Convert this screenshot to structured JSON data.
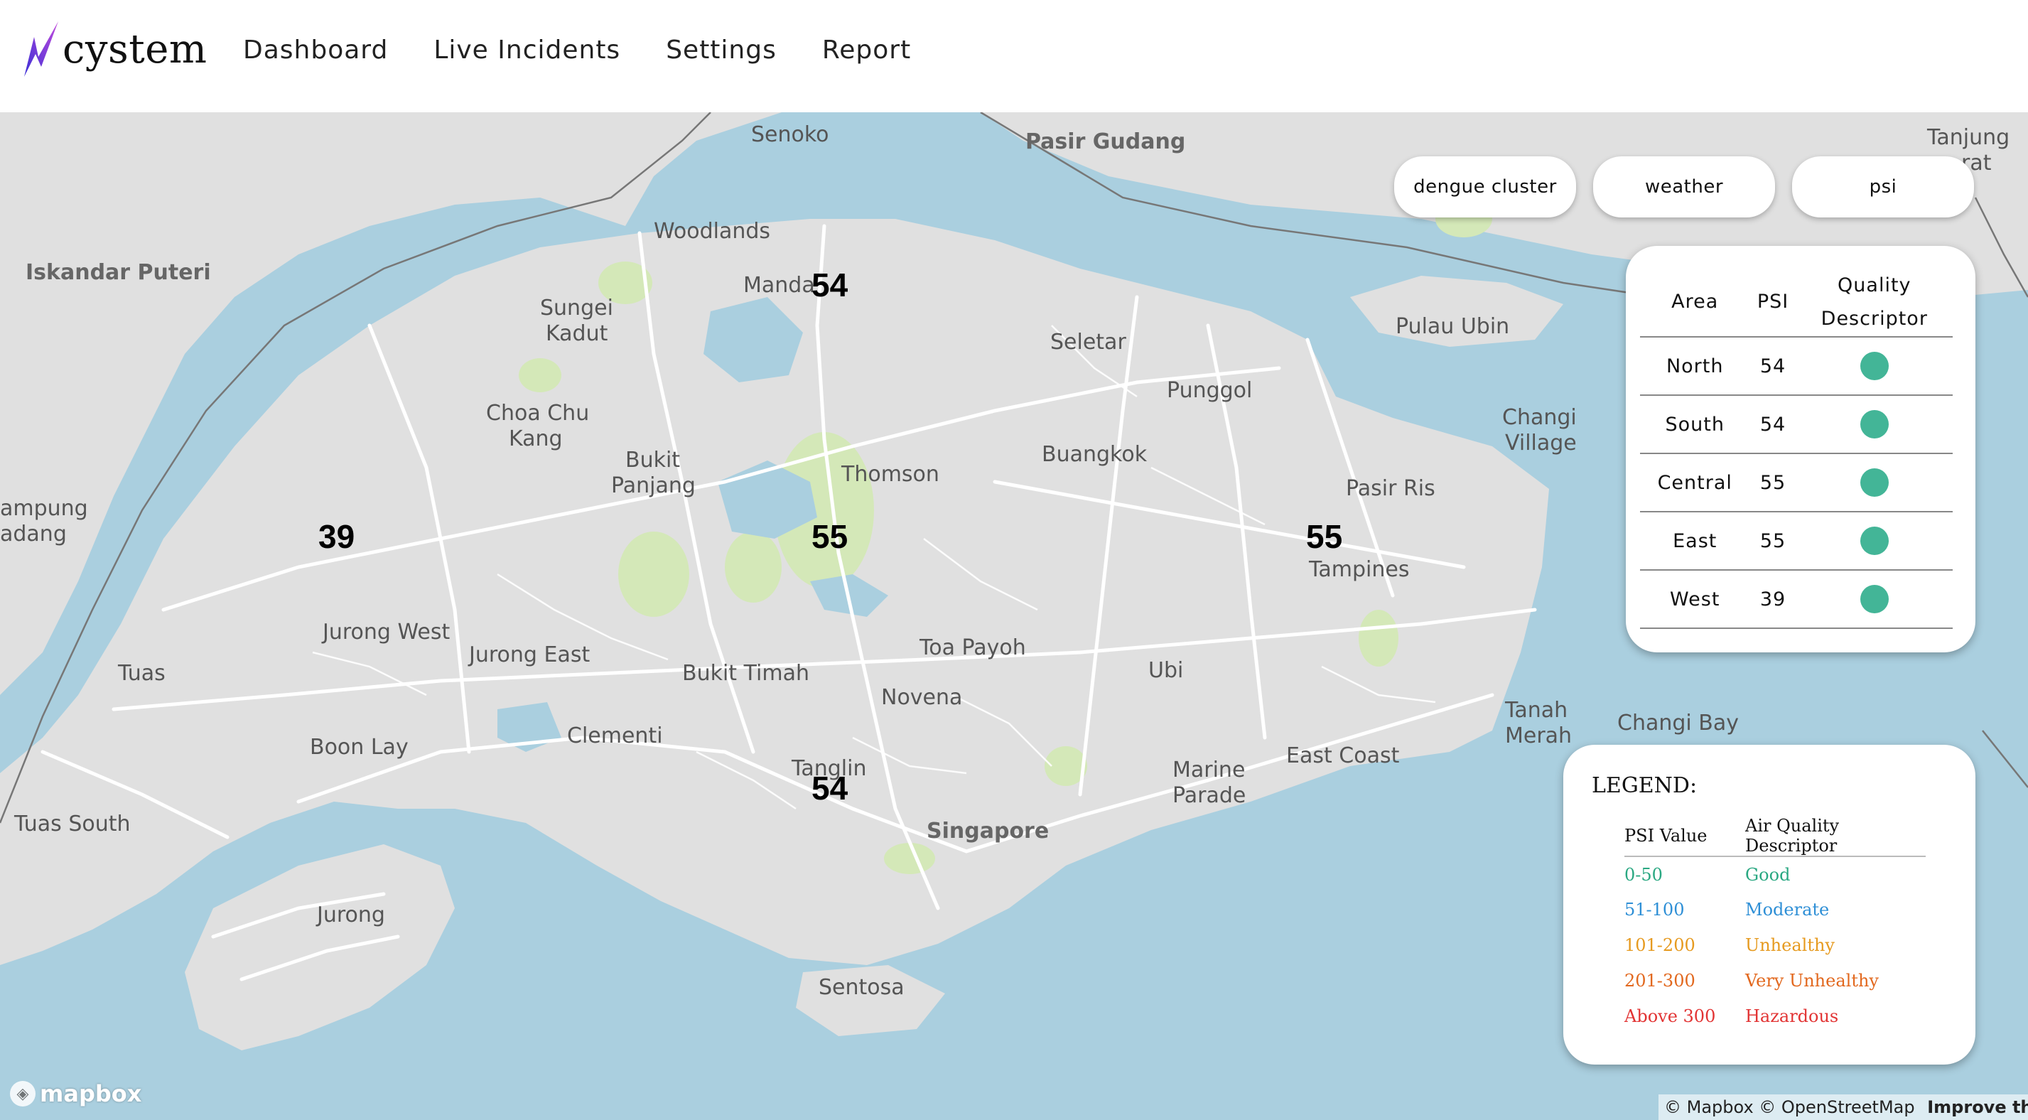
{
  "app": {
    "brand": "cystem"
  },
  "nav": {
    "items": [
      {
        "label": "Dashboard"
      },
      {
        "label": "Live Incidents"
      },
      {
        "label": "Settings"
      },
      {
        "label": "Report"
      }
    ]
  },
  "filters": [
    {
      "label": "dengue cluster"
    },
    {
      "label": "weather"
    },
    {
      "label": "psi"
    }
  ],
  "psi_panel": {
    "headers": {
      "area": "Area",
      "psi": "PSI",
      "quality_line1": "Quality",
      "quality_line2": "Descriptor"
    },
    "status_color": "#43b597",
    "rows": [
      {
        "area": "North",
        "psi": "54"
      },
      {
        "area": "South",
        "psi": "54"
      },
      {
        "area": "Central",
        "psi": "55"
      },
      {
        "area": "East",
        "psi": "55"
      },
      {
        "area": "West",
        "psi": "39"
      }
    ]
  },
  "legend": {
    "title": "LEGEND:",
    "headers": {
      "value": "PSI Value",
      "descriptor": "Air Quality Descriptor"
    },
    "rows": [
      {
        "range": "0-50",
        "descriptor": "Good",
        "color": "#2aa882"
      },
      {
        "range": "51-100",
        "descriptor": "Moderate",
        "color": "#2e8fd6"
      },
      {
        "range": "101-200",
        "descriptor": "Unhealthy",
        "color": "#e69a1f"
      },
      {
        "range": "201-300",
        "descriptor": "Very Unhealthy",
        "color": "#e2681e"
      },
      {
        "range": "Above 300",
        "descriptor": "Hazardous",
        "color": "#e23434"
      }
    ]
  },
  "map": {
    "colors": {
      "water": "#aacfdf",
      "land": "#e0e0e0",
      "park": "#d4e8b8",
      "road": "#ffffff"
    },
    "psi_markers": {
      "north": "54",
      "west": "39",
      "central": "55",
      "east": "55",
      "south": "54"
    },
    "labels": {
      "senoko": "Senoko",
      "pasir_gudang": "Pasir Gudang",
      "tanjung_1": "Tanjung",
      "tanjung_2": "rat",
      "woodlands": "Woodlands",
      "iskandar": "Iskandar Puteri",
      "mandai": "Manda",
      "sungei_1": "Sungei",
      "sungei_2": "Kadut",
      "seletar": "Seletar",
      "pulau_ubin": "Pulau Ubin",
      "punggol": "Punggol",
      "changi_v1": "Changi",
      "changi_v2": "Village",
      "choa_1": "Choa Chu",
      "choa_2": "Kang",
      "bukit_p1": "Bukit",
      "bukit_p2": "Panjang",
      "thomson": "Thomson",
      "buangkok": "Buangkok",
      "pasir_ris": "Pasir Ris",
      "ampung_1": "ampung",
      "ampung_2": "adang",
      "tampines": "Tampines",
      "jurong_west": "Jurong West",
      "jurong_east": "Jurong East",
      "toa_payoh": "Toa Payoh",
      "tuas": "Tuas",
      "bukit_timah": "Bukit Timah",
      "ubi": "Ubi",
      "novena": "Novena",
      "tanah_1": "Tanah",
      "tanah_2": "Merah",
      "changi_bay": "Changi Bay",
      "boon_lay": "Boon Lay",
      "clementi": "Clementi",
      "east_coast": "East Coast",
      "tanglin": "Tanglin",
      "marine_1": "Marine",
      "marine_2": "Parade",
      "tuas_south": "Tuas South",
      "singapore": "Singapore",
      "jurong": "Jurong",
      "sentosa": "Sentosa"
    }
  },
  "attribution": {
    "logo_text": "mapbox",
    "text": "© Mapbox © OpenStreetMap",
    "improve": "Improve this ma"
  }
}
